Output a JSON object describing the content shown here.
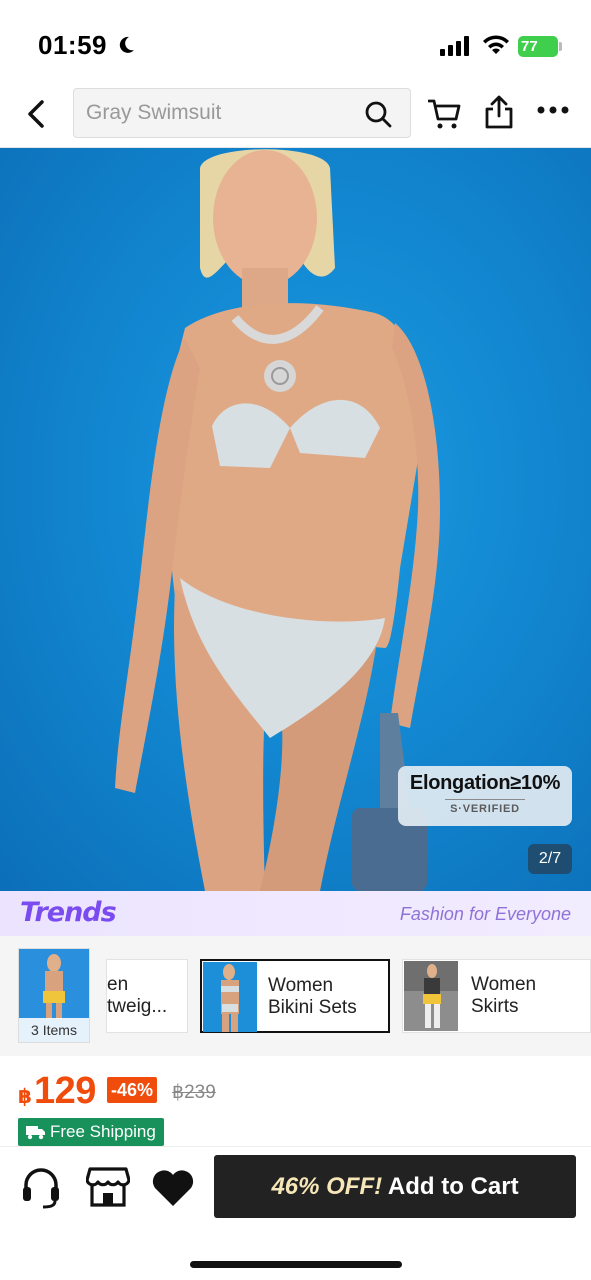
{
  "status_bar": {
    "time": "01:59",
    "battery": "77"
  },
  "nav": {
    "search_placeholder": "Gray Swimsuit"
  },
  "hero": {
    "badge_title": "Elongation≥10%",
    "badge_subtitle": "S·VERIFIED",
    "page_indicator": "2/7"
  },
  "trends": {
    "logo": "Trends",
    "tagline": "Fashion for Everyone",
    "items_count": "3 Items",
    "cards": [
      {
        "line1": "en",
        "line2": "tweig..."
      },
      {
        "line1": "Women",
        "line2": "Bikini Sets"
      },
      {
        "line1": "Women",
        "line2": "Skirts"
      }
    ]
  },
  "price": {
    "currency": "฿",
    "value": "129",
    "discount": "-46%",
    "original": "฿239",
    "shipping": "Free Shipping"
  },
  "bottom_bar": {
    "cart_button_off": "46% OFF!",
    "cart_button_label": "Add to Cart"
  },
  "colors": {
    "accent": "#f04c0c",
    "trends_purple": "#7a4cf0",
    "shipping_green": "#18915a"
  }
}
